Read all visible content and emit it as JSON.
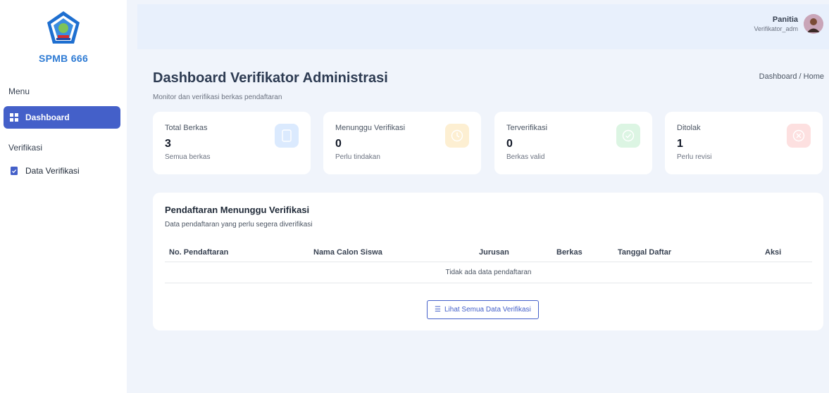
{
  "sidebar": {
    "brand": "SPMB 666",
    "sections": {
      "menu": "Menu",
      "verifikasi": "Verifikasi"
    },
    "items": [
      {
        "label": "Dashboard",
        "icon": "grid-icon",
        "active": true
      },
      {
        "label": "Data Verifikasi",
        "icon": "checklist-icon",
        "active": false
      }
    ]
  },
  "topbar": {
    "user_name": "Panitia",
    "user_role": "Verifikator_adm"
  },
  "page": {
    "title": "Dashboard Verifikator Administrasi",
    "subtitle": "Monitor dan verifikasi berkas pendaftaran",
    "breadcrumb": "Dashboard / Home"
  },
  "stats": [
    {
      "label": "Total Berkas",
      "value": "3",
      "note": "Semua berkas",
      "icon": "file-icon",
      "color": "#3b82f6",
      "bg": "#dbeafe"
    },
    {
      "label": "Menunggu Verifikasi",
      "value": "0",
      "note": "Perlu tindakan",
      "icon": "clock-icon",
      "color": "#f59e0b",
      "bg": "#fdefd2"
    },
    {
      "label": "Terverifikasi",
      "value": "0",
      "note": "Berkas valid",
      "icon": "check-circle-icon",
      "color": "#22c55e",
      "bg": "#dcf5e3"
    },
    {
      "label": "Ditolak",
      "value": "1",
      "note": "Perlu revisi",
      "icon": "x-circle-icon",
      "color": "#ef4444",
      "bg": "#fde0e0"
    }
  ],
  "table": {
    "title": "Pendaftaran Menunggu Verifikasi",
    "subtitle": "Data pendaftaran yang perlu segera diverifikasi",
    "columns": [
      "No. Pendaftaran",
      "Nama Calon Siswa",
      "Jurusan",
      "Berkas",
      "Tanggal Daftar",
      "Aksi"
    ],
    "empty_text": "Tidak ada data pendaftaran",
    "button_label": "Lihat Semua Data Verifikasi"
  },
  "colors": {
    "accent": "#4460c9",
    "brand": "#2e7bd4"
  }
}
